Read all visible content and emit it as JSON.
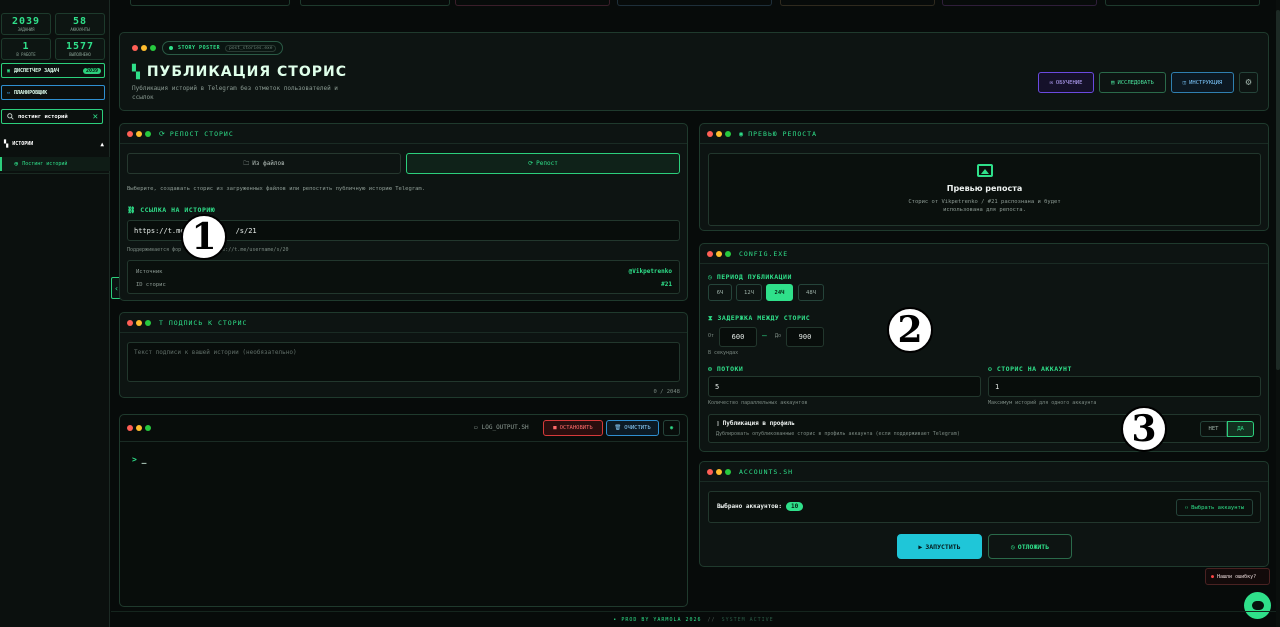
{
  "sidebar": {
    "stats": [
      {
        "value": "2039",
        "label": "задания"
      },
      {
        "value": "58",
        "label": "аккаунты"
      },
      {
        "value": "1",
        "label": "в работе"
      },
      {
        "value": "1577",
        "label": "выполнено"
      }
    ],
    "dispatcher_label": "ДИСПЕТЧЕР ЗАДАЧ",
    "dispatcher_badge": "2039",
    "planner_label": "ПЛАНИРОВЩИК",
    "search_value": "постинг историй",
    "section_label": "Истории",
    "item_label": "Постинг историй"
  },
  "header": {
    "pill_label": "STORY POSTER",
    "pill_file": "post_stories.exe",
    "title": "ПУБЛИКАЦИЯ СТОРИС",
    "subtitle_line1": "Публикация историй в Telegram без отметок пользователей и",
    "subtitle_line2": "ссылок",
    "btn_learning": "ОБУЧЕНИЕ",
    "btn_research": "ИССЛЕДОВАТЬ",
    "btn_instruction": "ИНСТРУКЦИЯ"
  },
  "repost": {
    "title": "РЕПОСТ СТОРИС",
    "tab_files": "Из файлов",
    "tab_repost": "Репост",
    "description": "Выберите, создавать сторис из загруженных файлов или репостить публичную историю Telegram.",
    "link_label": "ССЫЛКА НА ИСТОРИЮ",
    "link_value_a": "https://t.me",
    "link_value_b": "/s/21",
    "hint_a": "Поддерживается фор",
    "hint_b": "ка https://t.me/username/s/20",
    "source_label": "Источник",
    "source_value": "@Vikpetrenko",
    "id_label": "ID сторис",
    "id_value": "#21"
  },
  "caption": {
    "title": "T ПОДПИСЬ К СТОРИС",
    "placeholder": "Текст подписи к вашей истории (необязательно)",
    "counter": "0 / 2048"
  },
  "log": {
    "file": "LOG_OUTPUT.SH",
    "stop": "ОСТАНОВИТЬ",
    "clear": "ОЧИСТИТЬ",
    "prompt": ">",
    "cursor": "_"
  },
  "preview": {
    "title": "ПРЕВЬЮ РЕПОСТА",
    "heading": "Превью репоста",
    "text_line1": "Сторис от Vikpetrenko / #21 распознана и будет",
    "text_line2": "использована для репоста."
  },
  "config": {
    "title": "CONFIG.EXE",
    "period_label": "ПЕРИОД ПУБЛИКАЦИИ",
    "periods": [
      "6Ч",
      "12Ч",
      "24Ч",
      "48Ч"
    ],
    "delay_label": "ЗАДЕРЖКА МЕЖДУ СТОРИС",
    "from_label": "От",
    "from_value": "600",
    "dash": "—",
    "to_label": "До",
    "to_value": "900",
    "seconds_hint": "В секундах",
    "threads_label": "ПОТОКИ",
    "threads_value": "5",
    "threads_hint": "Количество параллельных аккаунтов",
    "per_account_label": "СТОРИС НА АККАУНТ",
    "per_account_value": "1",
    "per_account_hint": "Максимум историй для одного аккаунта",
    "profile_title": "Публикация в профиль",
    "profile_hint": "Дублировать опубликованные сторис в профиль аккаунта (если поддерживает Telegram)",
    "no": "НЕТ",
    "yes": "ДА"
  },
  "accounts": {
    "title": "ACCOUNTS.SH",
    "selected_label": "Выбрано аккаунтов:",
    "selected_count": "10",
    "choose_btn": "Выбрать аккаунты"
  },
  "actions": {
    "run": "ЗАПУСТИТЬ",
    "postpone": "ОТЛОЖИТЬ"
  },
  "bug": "Нашли ошибку?",
  "footer": {
    "left": "• PROD BY YARMOLA 2026",
    "sep": "//",
    "right": "SYSTEM ACTIVE"
  },
  "annotations": [
    "1",
    "2",
    "3"
  ]
}
